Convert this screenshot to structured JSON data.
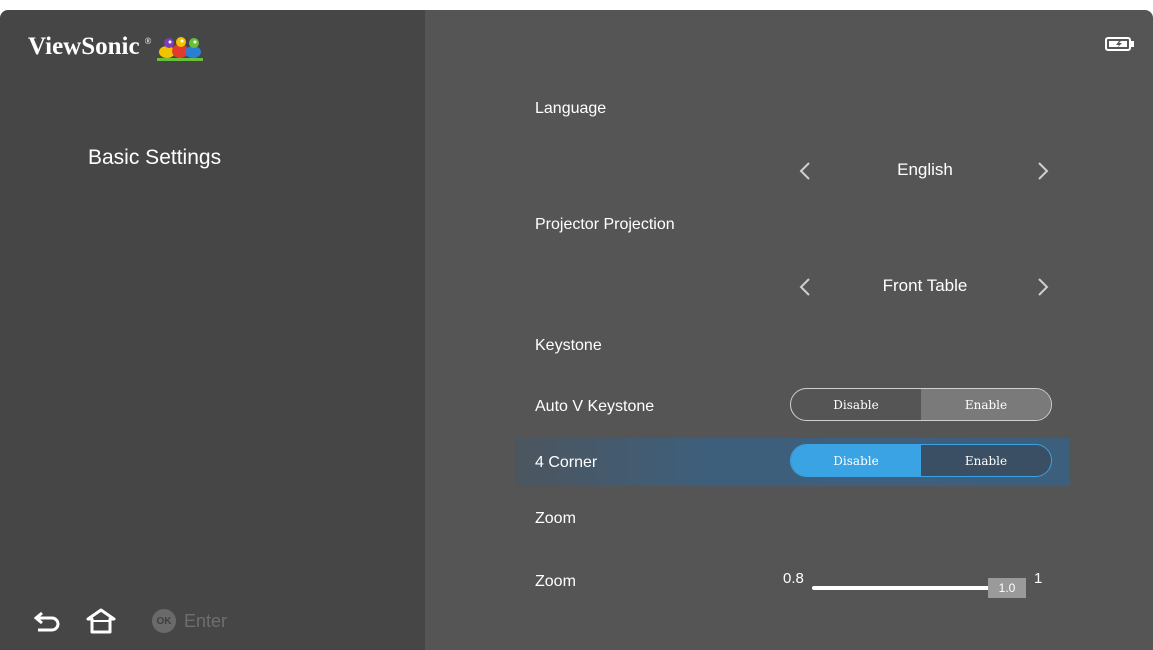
{
  "brand": {
    "name": "ViewSonic",
    "mark": "®"
  },
  "sidebar": {
    "title": "Basic Settings"
  },
  "bottom_nav": {
    "ok_badge": "OK",
    "enter_label": "Enter"
  },
  "settings": {
    "language": {
      "label": "Language",
      "value": "English"
    },
    "projection": {
      "label": "Projector Projection",
      "value": "Front Table"
    },
    "keystone_header": "Keystone",
    "auto_v_keystone": {
      "label": "Auto V Keystone",
      "options": [
        "Disable",
        "Enable"
      ],
      "selected": "Enable"
    },
    "four_corner": {
      "label": "4 Corner",
      "options": [
        "Disable",
        "Enable"
      ],
      "selected": "Disable",
      "focused": true
    },
    "zoom_header": "Zoom",
    "zoom": {
      "label": "Zoom",
      "min": "0.8",
      "max": "1",
      "value": "1.0"
    }
  },
  "colors": {
    "left_panel": "#464646",
    "right_panel": "#555555",
    "accent": "#3aa3e3",
    "focus_row": "#3d5f7e"
  },
  "icons": [
    "back-icon",
    "home-icon",
    "battery-icon",
    "chevron-left-icon",
    "chevron-right-icon"
  ]
}
